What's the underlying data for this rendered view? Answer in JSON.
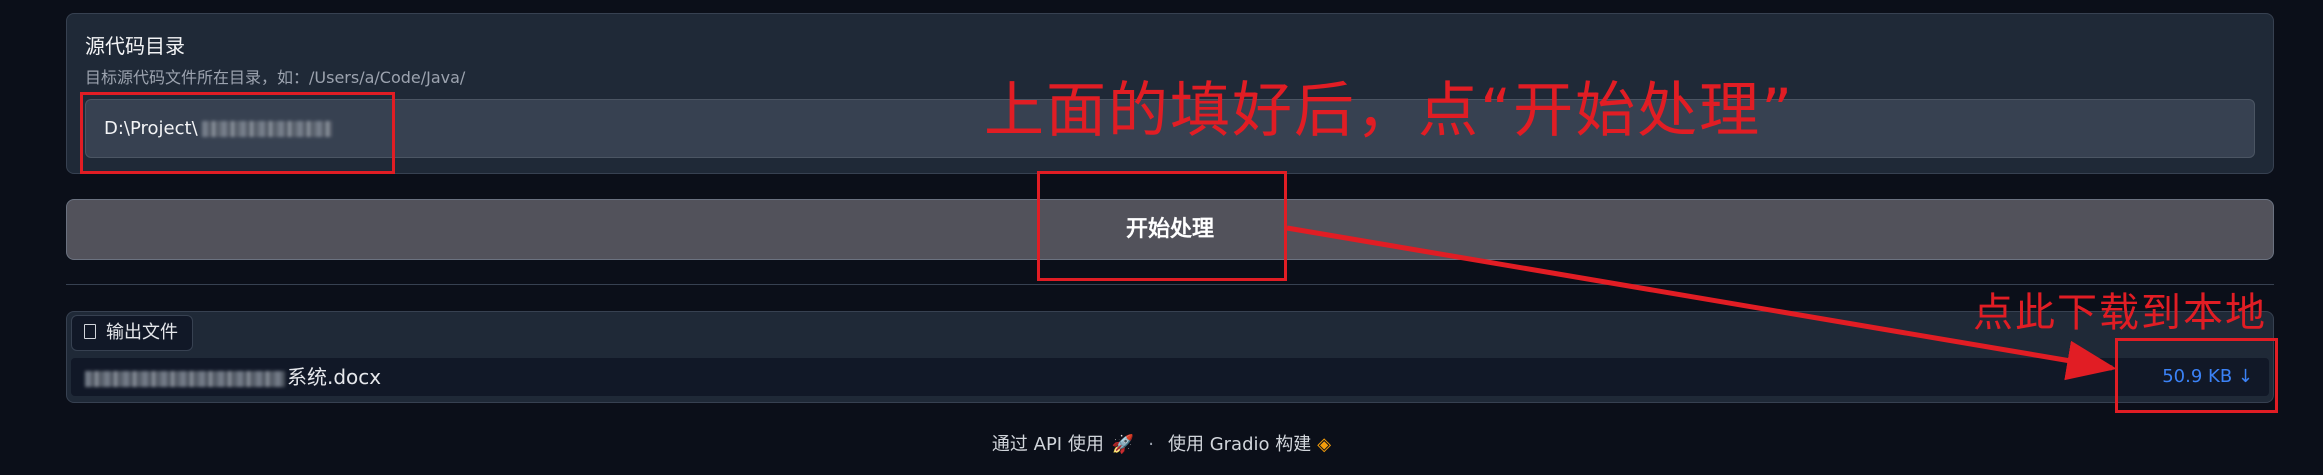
{
  "source_dir": {
    "label": "源代码目录",
    "info": "目标源代码文件所在目录，如：/Users/a/Code/Java/",
    "value_prefix": "D:\\Project\\"
  },
  "run_button": {
    "label": "开始处理"
  },
  "output": {
    "tab_label": "输出文件",
    "file_name_suffix": "系统.docx",
    "file_size": "50.9 KB ↓"
  },
  "footer": {
    "api_text": "通过 API 使用",
    "separator": "·",
    "built_text": "使用 Gradio 构建"
  },
  "annotations": {
    "top_text": "上面的填好后，点“开始处理”",
    "right_text": "点此下载到本地",
    "color": "#e11d24"
  },
  "icons": [
    "file-icon",
    "rocket-icon",
    "gradio-logo-icon",
    "download-arrow-icon"
  ]
}
